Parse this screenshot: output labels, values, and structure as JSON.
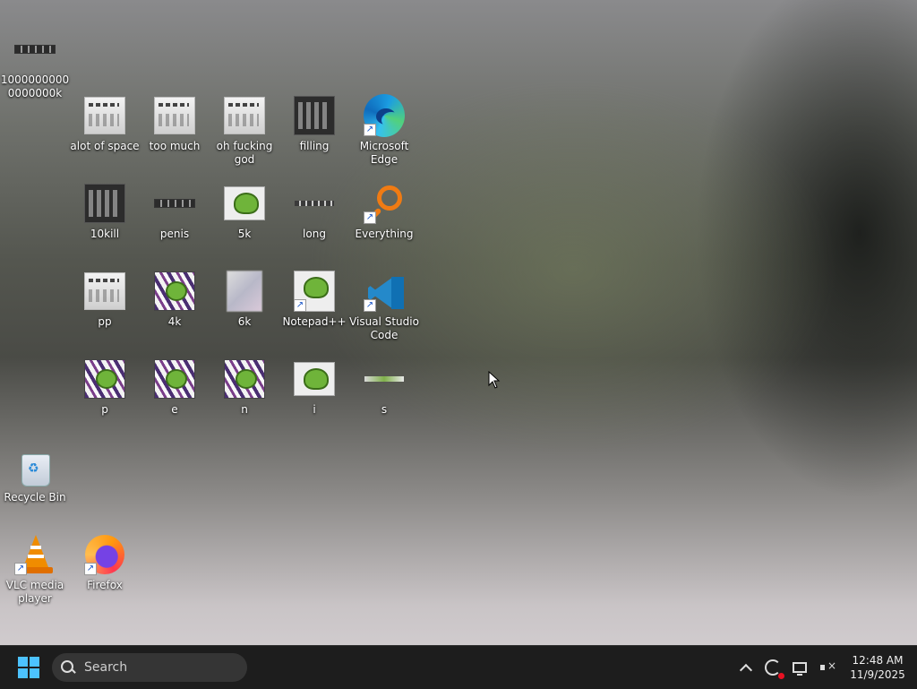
{
  "desktop": {
    "icons": [
      {
        "id": "100k",
        "label": "10000000000000000k"
      },
      {
        "id": "alot",
        "label": "alot of space"
      },
      {
        "id": "toomuch",
        "label": "too much"
      },
      {
        "id": "ohgod",
        "label": "oh fucking god"
      },
      {
        "id": "filling",
        "label": "filling"
      },
      {
        "id": "edge",
        "label": "Microsoft Edge"
      },
      {
        "id": "10kill",
        "label": "10kill"
      },
      {
        "id": "penis",
        "label": "penis"
      },
      {
        "id": "5k",
        "label": "5k"
      },
      {
        "id": "long",
        "label": "long"
      },
      {
        "id": "everything",
        "label": "Everything"
      },
      {
        "id": "pp",
        "label": "pp"
      },
      {
        "id": "4k",
        "label": "4k"
      },
      {
        "id": "6k",
        "label": "6k"
      },
      {
        "id": "notepadpp",
        "label": "Notepad++"
      },
      {
        "id": "vscode",
        "label": "Visual Studio Code"
      },
      {
        "id": "p",
        "label": "p"
      },
      {
        "id": "e",
        "label": "e"
      },
      {
        "id": "n",
        "label": "n"
      },
      {
        "id": "i",
        "label": "i"
      },
      {
        "id": "s",
        "label": "s"
      },
      {
        "id": "recyclebin",
        "label": "Recycle Bin"
      },
      {
        "id": "vlc",
        "label": "VLC media player"
      },
      {
        "id": "firefox",
        "label": "Firefox"
      }
    ]
  },
  "taskbar": {
    "search_placeholder": "Search",
    "clock_time": "12:48 AM",
    "clock_date": "11/9/2025"
  },
  "colors": {
    "start_accent": "#4cc2ff",
    "taskbar_bg": "#1d1d1d",
    "notification_dot": "#e81123"
  }
}
